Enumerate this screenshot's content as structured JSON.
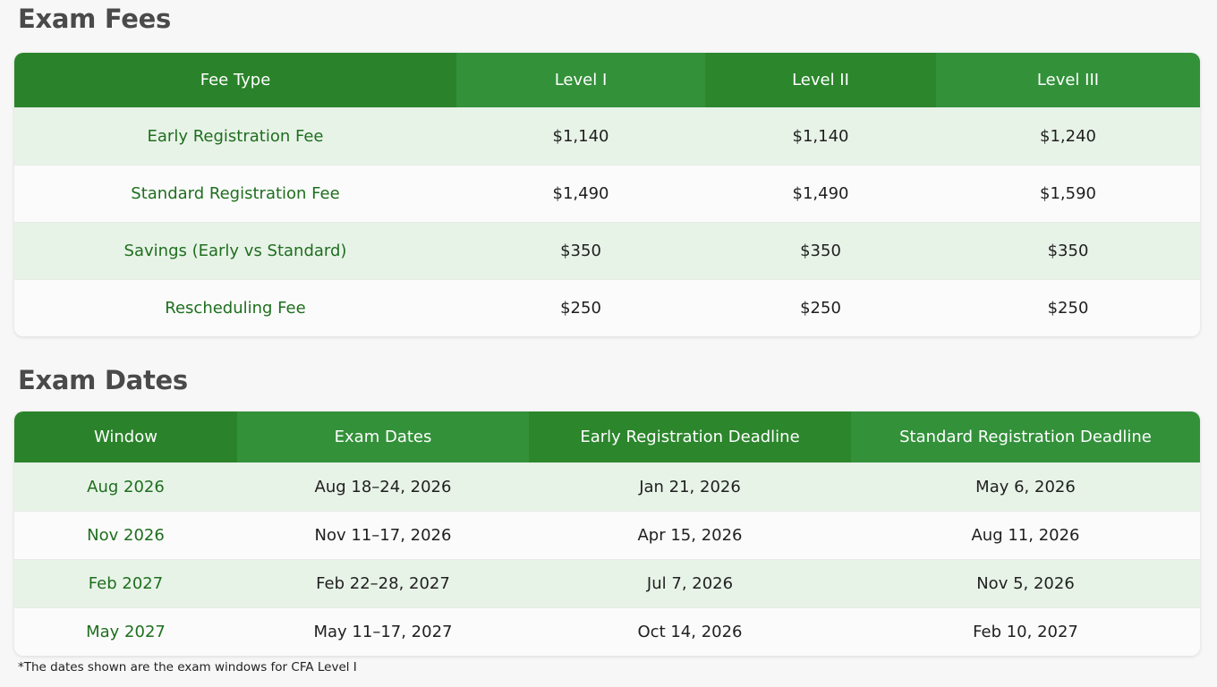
{
  "fees": {
    "title": "Exam Fees",
    "headers": [
      "Fee Type",
      "Level I",
      "Level II",
      "Level III"
    ],
    "rows": [
      {
        "type": "Early Registration Fee",
        "level1": "$1,140",
        "level2": "$1,140",
        "level3": "$1,240"
      },
      {
        "type": "Standard Registration Fee",
        "level1": "$1,490",
        "level2": "$1,490",
        "level3": "$1,590"
      },
      {
        "type": "Savings (Early vs Standard)",
        "level1": "$350",
        "level2": "$350",
        "level3": "$350"
      },
      {
        "type": "Rescheduling Fee",
        "level1": "$250",
        "level2": "$250",
        "level3": "$250"
      }
    ]
  },
  "dates": {
    "title": "Exam Dates",
    "headers": [
      "Window",
      "Exam Dates",
      "Early Registration Deadline",
      "Standard Registration Deadline"
    ],
    "rows": [
      {
        "window": "Aug 2026",
        "exam_dates": "Aug 18–24, 2026",
        "early_deadline": "Jan 21, 2026",
        "standard_deadline": "May 6, 2026"
      },
      {
        "window": "Nov 2026",
        "exam_dates": "Nov 11–17, 2026",
        "early_deadline": "Apr 15, 2026",
        "standard_deadline": "Aug 11, 2026"
      },
      {
        "window": "Feb 2027",
        "exam_dates": "Feb 22–28, 2027",
        "early_deadline": "Jul 7, 2026",
        "standard_deadline": "Nov 5, 2026"
      },
      {
        "window": "May 2027",
        "exam_dates": "May 11–17, 2027",
        "early_deadline": "Oct 14, 2026",
        "standard_deadline": "Feb 10, 2027"
      }
    ]
  },
  "footnote": "*The dates shown are the exam windows for CFA Level I",
  "colors": {
    "header_green": "#2e8b2e",
    "label_green": "#1e6e1e",
    "row_tint": "#e8f3e8"
  }
}
